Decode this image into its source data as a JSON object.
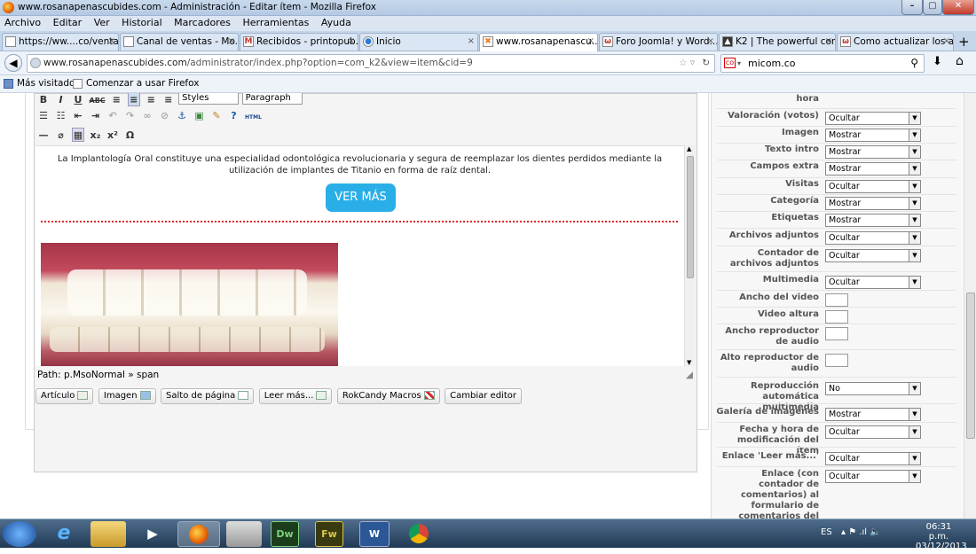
{
  "window": {
    "title": "www.rosanapenascubides.com - Administración - Editar ítem - Mozilla Firefox",
    "min": "–",
    "max": "▢",
    "close": "✕"
  },
  "menu": [
    "Archivo",
    "Editar",
    "Ver",
    "Historial",
    "Marcadores",
    "Herramientas",
    "Ayuda"
  ],
  "tabs": [
    {
      "label": "https://ww....co/ventas/",
      "icon": ""
    },
    {
      "label": "Canal de ventas - Mo...",
      "icon": ""
    },
    {
      "label": "Recibidos - printopub...",
      "icon": "M"
    },
    {
      "label": "Inicio",
      "icon": "●"
    },
    {
      "label": "www.rosanapenascu...",
      "icon": "✖"
    },
    {
      "label": "Foro Joomla! y Word...",
      "icon": "ω"
    },
    {
      "label": "K2 | The powerful con...",
      "icon": "▲"
    },
    {
      "label": "Como actualizar los a...",
      "icon": "ω"
    }
  ],
  "tab_close": "×",
  "new_tab": "+",
  "nav": {
    "url_domain": "www.rosanapenascubides.com",
    "url_path": "/administrator/index.php?option=com_k2&view=item&cid=9",
    "search_value": "micom.co"
  },
  "bookmarks": [
    "Más visitados",
    "Comenzar a usar Firefox"
  ],
  "editor": {
    "styles": "Styles",
    "paragraph": "Paragraph",
    "paragraph_text": "La Implantología Oral constituye una especialidad odontológica revolucionaria y segura de reemplazar los dientes perdidos mediante la utilización de implantes de Titanio en forma de raíz dental.",
    "button_label": "VER MÁS",
    "path": "Path: p.MsoNormal » span",
    "buttons": [
      "Artículo",
      "Imagen",
      "Salto de página",
      "Leer más...",
      "RokCandy Macros",
      "Cambiar editor"
    ]
  },
  "panel": {
    "rows": [
      {
        "label": "hora",
        "type": "none"
      },
      {
        "label": "Valoración (votos)",
        "type": "select",
        "value": "Ocultar"
      },
      {
        "label": "Imagen",
        "type": "select",
        "value": "Mostrar"
      },
      {
        "label": "Texto intro",
        "type": "select",
        "value": "Mostrar"
      },
      {
        "label": "Campos extra",
        "type": "select",
        "value": "Mostrar"
      },
      {
        "label": "Visitas",
        "type": "select",
        "value": "Ocultar"
      },
      {
        "label": "Categoría",
        "type": "select",
        "value": "Mostrar"
      },
      {
        "label": "Etiquetas",
        "type": "select",
        "value": "Mostrar"
      },
      {
        "label": "Archivos adjuntos",
        "type": "select",
        "value": "Ocultar"
      },
      {
        "label": "Contador de archivos adjuntos",
        "type": "select",
        "value": "Ocultar"
      },
      {
        "label": "Multimedia",
        "type": "select",
        "value": "Ocultar"
      },
      {
        "label": "Ancho del video",
        "type": "input",
        "value": ""
      },
      {
        "label": "Video altura",
        "type": "input",
        "value": ""
      },
      {
        "label": "Ancho reproductor de audio",
        "type": "input",
        "value": ""
      },
      {
        "label": "Alto reproductor de audio",
        "type": "input",
        "value": ""
      },
      {
        "label": "Reproducción automática multimedia",
        "type": "select",
        "value": "No"
      },
      {
        "label": "Galería de imágenes",
        "type": "select",
        "value": "Mostrar"
      },
      {
        "label": "Fecha y hora de modificación del ítem",
        "type": "select",
        "value": "Ocultar"
      },
      {
        "label": "Enlace 'Leer más...'",
        "type": "select",
        "value": "Ocultar"
      },
      {
        "label": "Enlace (con contador de comentarios) al formulario de comentarios del artículo",
        "type": "select",
        "value": "Ocultar"
      }
    ]
  },
  "taskbar": {
    "lang": "ES",
    "time": "06:31 p.m.",
    "date": "03/12/2013",
    "apps": [
      "Dw",
      "Fw",
      "W"
    ]
  }
}
